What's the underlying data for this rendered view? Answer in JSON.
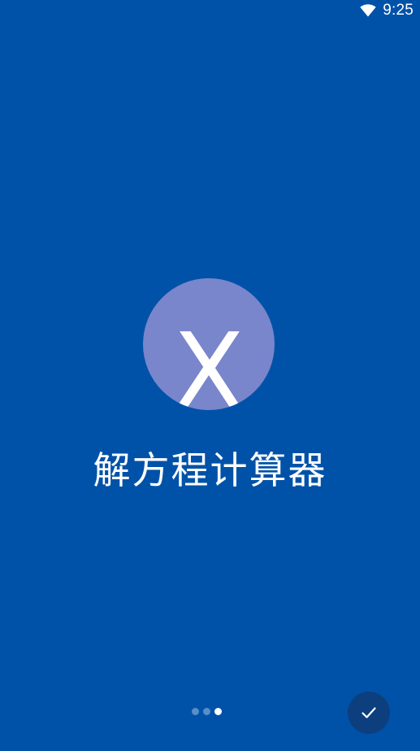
{
  "colors": {
    "background": "#0052A8",
    "logo_circle": "#7986CB",
    "done_button": "#0D3F7E",
    "text": "#FFFFFF"
  },
  "status_bar": {
    "time": "9:25",
    "icons": [
      "wifi-icon"
    ]
  },
  "logo": {
    "letter": "X"
  },
  "app": {
    "title": "解方程计算器"
  },
  "pager": {
    "total": 3,
    "current": 3
  },
  "done_button": {
    "icon": "check-icon"
  }
}
